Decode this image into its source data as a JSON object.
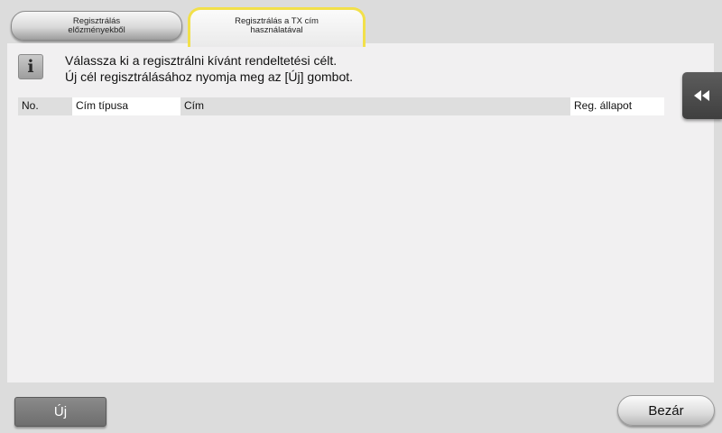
{
  "tabs": [
    {
      "label": "Regisztrálás\nelőzményekből",
      "active": false
    },
    {
      "label": "Regisztrálás a TX cím\nhasználatával",
      "active": true
    }
  ],
  "message": {
    "icon": "info-icon",
    "line1": "Válassza ki a regisztrálni kívánt rendeltetési célt.",
    "line2": "Új cél regisztrálásához nyomja meg az [Új] gombot."
  },
  "table": {
    "columns": [
      "No.",
      "Cím típusa",
      "Cím",
      "Reg. állapot"
    ],
    "rows": []
  },
  "side_panel": {
    "icon": "double-chevron-left-icon"
  },
  "buttons": {
    "new_label": "Új",
    "close_label": "Bezár"
  },
  "colors": {
    "active_tab_border": "#f2e04a",
    "panel_background": "#f1f0f1",
    "screen_background": "#dcdcdc"
  }
}
